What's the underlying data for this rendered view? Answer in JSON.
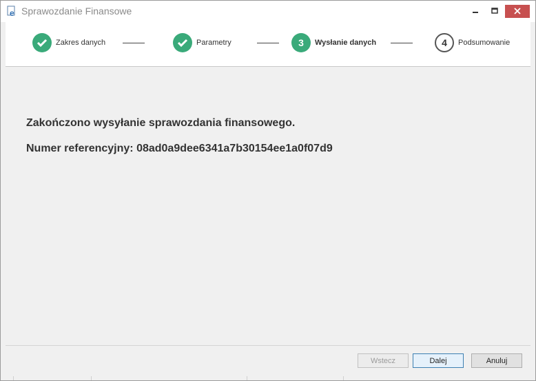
{
  "window": {
    "title": "Sprawozdanie Finansowe",
    "controls": [
      "minimize-icon",
      "maximize-icon",
      "close-icon"
    ],
    "close_color": "#c75050"
  },
  "stepper": {
    "steps": [
      {
        "label": "Zakres danych",
        "state": "done",
        "icon": "check-icon"
      },
      {
        "label": "Parametry",
        "state": "done",
        "icon": "check-icon"
      },
      {
        "number": "3",
        "label": "Wysłanie danych",
        "state": "active"
      },
      {
        "number": "4",
        "label": "Podsumowanie",
        "state": "pending"
      }
    ],
    "accent": "#3aaa7a"
  },
  "content": {
    "message": "Zakończono wysyłanie sprawozdania finansowego.",
    "reference": "Numer referencyjny: 08ad0a9dee6341a7b30154ee1a0f07d9"
  },
  "footer": {
    "back_label": "Wstecz",
    "next_label": "Dalej",
    "cancel_label": "Anuluj"
  }
}
